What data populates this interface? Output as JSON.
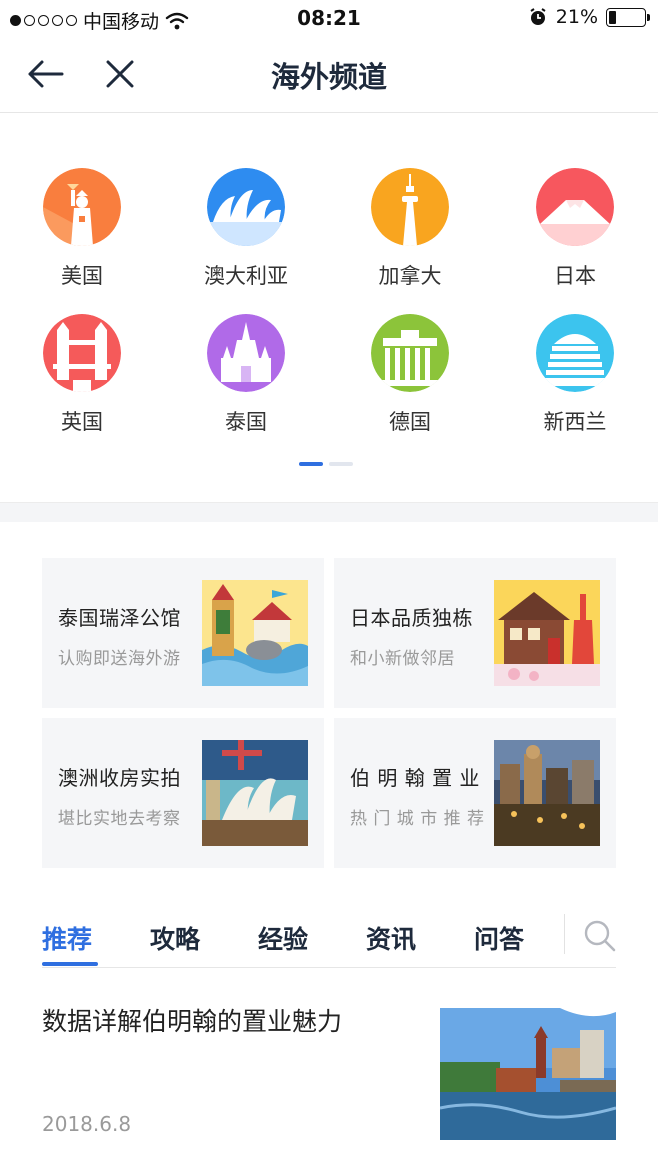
{
  "status_bar": {
    "carrier": "中国移动",
    "time": "08:21",
    "battery": "21%"
  },
  "nav": {
    "title": "海外频道"
  },
  "countries": [
    {
      "label": "美国",
      "icon": "statue-of-liberty-icon",
      "color": "#f97e3e"
    },
    {
      "label": "澳大利亚",
      "icon": "sydney-opera-house-icon",
      "color": "#2e8cf0"
    },
    {
      "label": "加拿大",
      "icon": "cn-tower-icon",
      "color": "#f9a51f"
    },
    {
      "label": "日本",
      "icon": "mount-fuji-icon",
      "color": "#f7575e"
    },
    {
      "label": "英国",
      "icon": "tower-bridge-icon",
      "color": "#f55a5a"
    },
    {
      "label": "泰国",
      "icon": "thai-temple-icon",
      "color": "#b06ae8"
    },
    {
      "label": "德国",
      "icon": "brandenburg-gate-icon",
      "color": "#8cc43a"
    },
    {
      "label": "新西兰",
      "icon": "beehive-building-icon",
      "color": "#3cc4ee"
    }
  ],
  "pager": {
    "pages": 2,
    "active": 1
  },
  "projects": [
    {
      "title": "泰国瑞泽公馆",
      "subtitle": "认购即送海外游"
    },
    {
      "title": "日本品质独栋",
      "subtitle": "和小新做邻居"
    },
    {
      "title": "澳洲收房实拍",
      "subtitle": "堪比实地去考察"
    },
    {
      "title": "伯 明 翰 置 业",
      "subtitle": "热 门 城 市 推 荐"
    }
  ],
  "tabs": [
    "推荐",
    "攻略",
    "经验",
    "资讯",
    "问答"
  ],
  "active_tab": "推荐",
  "article": {
    "title": "数据详解伯明翰的置业魅力",
    "date": "2018.6.8"
  },
  "colors": {
    "accent": "#2f6fe0",
    "title": "#1e2a3c"
  }
}
